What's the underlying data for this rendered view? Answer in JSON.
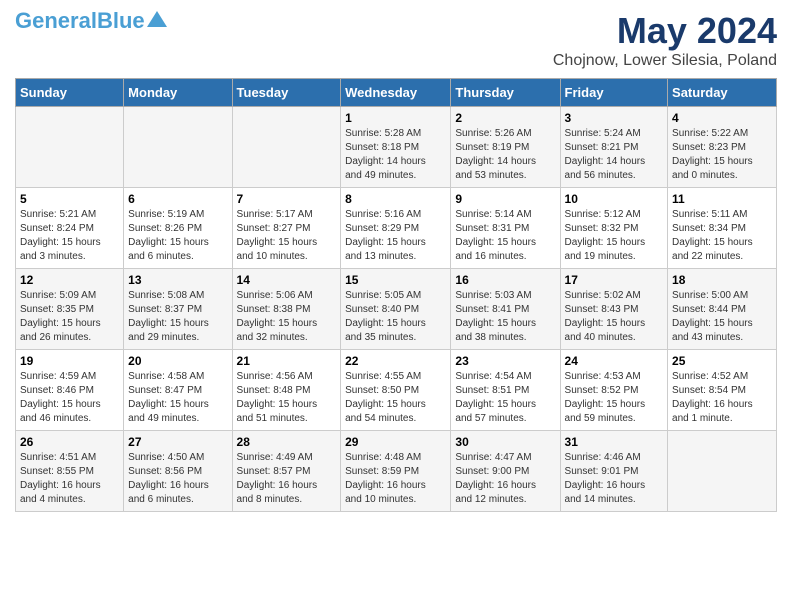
{
  "header": {
    "logo": {
      "line1": "General",
      "line2": "Blue"
    },
    "title": "May 2024",
    "subtitle": "Chojnow, Lower Silesia, Poland"
  },
  "days_of_week": [
    "Sunday",
    "Monday",
    "Tuesday",
    "Wednesday",
    "Thursday",
    "Friday",
    "Saturday"
  ],
  "weeks": [
    [
      {
        "day": "",
        "info": ""
      },
      {
        "day": "",
        "info": ""
      },
      {
        "day": "",
        "info": ""
      },
      {
        "day": "1",
        "info": "Sunrise: 5:28 AM\nSunset: 8:18 PM\nDaylight: 14 hours\nand 49 minutes."
      },
      {
        "day": "2",
        "info": "Sunrise: 5:26 AM\nSunset: 8:19 PM\nDaylight: 14 hours\nand 53 minutes."
      },
      {
        "day": "3",
        "info": "Sunrise: 5:24 AM\nSunset: 8:21 PM\nDaylight: 14 hours\nand 56 minutes."
      },
      {
        "day": "4",
        "info": "Sunrise: 5:22 AM\nSunset: 8:23 PM\nDaylight: 15 hours\nand 0 minutes."
      }
    ],
    [
      {
        "day": "5",
        "info": "Sunrise: 5:21 AM\nSunset: 8:24 PM\nDaylight: 15 hours\nand 3 minutes."
      },
      {
        "day": "6",
        "info": "Sunrise: 5:19 AM\nSunset: 8:26 PM\nDaylight: 15 hours\nand 6 minutes."
      },
      {
        "day": "7",
        "info": "Sunrise: 5:17 AM\nSunset: 8:27 PM\nDaylight: 15 hours\nand 10 minutes."
      },
      {
        "day": "8",
        "info": "Sunrise: 5:16 AM\nSunset: 8:29 PM\nDaylight: 15 hours\nand 13 minutes."
      },
      {
        "day": "9",
        "info": "Sunrise: 5:14 AM\nSunset: 8:31 PM\nDaylight: 15 hours\nand 16 minutes."
      },
      {
        "day": "10",
        "info": "Sunrise: 5:12 AM\nSunset: 8:32 PM\nDaylight: 15 hours\nand 19 minutes."
      },
      {
        "day": "11",
        "info": "Sunrise: 5:11 AM\nSunset: 8:34 PM\nDaylight: 15 hours\nand 22 minutes."
      }
    ],
    [
      {
        "day": "12",
        "info": "Sunrise: 5:09 AM\nSunset: 8:35 PM\nDaylight: 15 hours\nand 26 minutes."
      },
      {
        "day": "13",
        "info": "Sunrise: 5:08 AM\nSunset: 8:37 PM\nDaylight: 15 hours\nand 29 minutes."
      },
      {
        "day": "14",
        "info": "Sunrise: 5:06 AM\nSunset: 8:38 PM\nDaylight: 15 hours\nand 32 minutes."
      },
      {
        "day": "15",
        "info": "Sunrise: 5:05 AM\nSunset: 8:40 PM\nDaylight: 15 hours\nand 35 minutes."
      },
      {
        "day": "16",
        "info": "Sunrise: 5:03 AM\nSunset: 8:41 PM\nDaylight: 15 hours\nand 38 minutes."
      },
      {
        "day": "17",
        "info": "Sunrise: 5:02 AM\nSunset: 8:43 PM\nDaylight: 15 hours\nand 40 minutes."
      },
      {
        "day": "18",
        "info": "Sunrise: 5:00 AM\nSunset: 8:44 PM\nDaylight: 15 hours\nand 43 minutes."
      }
    ],
    [
      {
        "day": "19",
        "info": "Sunrise: 4:59 AM\nSunset: 8:46 PM\nDaylight: 15 hours\nand 46 minutes."
      },
      {
        "day": "20",
        "info": "Sunrise: 4:58 AM\nSunset: 8:47 PM\nDaylight: 15 hours\nand 49 minutes."
      },
      {
        "day": "21",
        "info": "Sunrise: 4:56 AM\nSunset: 8:48 PM\nDaylight: 15 hours\nand 51 minutes."
      },
      {
        "day": "22",
        "info": "Sunrise: 4:55 AM\nSunset: 8:50 PM\nDaylight: 15 hours\nand 54 minutes."
      },
      {
        "day": "23",
        "info": "Sunrise: 4:54 AM\nSunset: 8:51 PM\nDaylight: 15 hours\nand 57 minutes."
      },
      {
        "day": "24",
        "info": "Sunrise: 4:53 AM\nSunset: 8:52 PM\nDaylight: 15 hours\nand 59 minutes."
      },
      {
        "day": "25",
        "info": "Sunrise: 4:52 AM\nSunset: 8:54 PM\nDaylight: 16 hours\nand 1 minute."
      }
    ],
    [
      {
        "day": "26",
        "info": "Sunrise: 4:51 AM\nSunset: 8:55 PM\nDaylight: 16 hours\nand 4 minutes."
      },
      {
        "day": "27",
        "info": "Sunrise: 4:50 AM\nSunset: 8:56 PM\nDaylight: 16 hours\nand 6 minutes."
      },
      {
        "day": "28",
        "info": "Sunrise: 4:49 AM\nSunset: 8:57 PM\nDaylight: 16 hours\nand 8 minutes."
      },
      {
        "day": "29",
        "info": "Sunrise: 4:48 AM\nSunset: 8:59 PM\nDaylight: 16 hours\nand 10 minutes."
      },
      {
        "day": "30",
        "info": "Sunrise: 4:47 AM\nSunset: 9:00 PM\nDaylight: 16 hours\nand 12 minutes."
      },
      {
        "day": "31",
        "info": "Sunrise: 4:46 AM\nSunset: 9:01 PM\nDaylight: 16 hours\nand 14 minutes."
      },
      {
        "day": "",
        "info": ""
      }
    ]
  ]
}
